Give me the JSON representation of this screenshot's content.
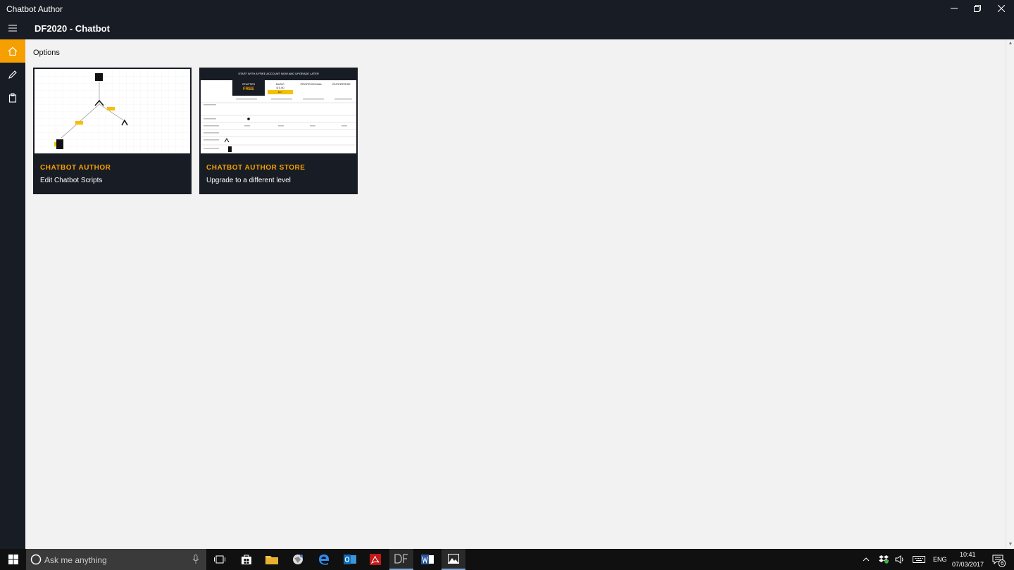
{
  "window": {
    "title": "Chatbot Author"
  },
  "appbar": {
    "title": "DF2020 - Chatbot"
  },
  "nav": {
    "items": [
      "home-icon",
      "pencil-icon",
      "clipboard-icon"
    ],
    "active_color": "#f5a000"
  },
  "content": {
    "heading": "Options"
  },
  "tiles": [
    {
      "name": "CHATBOT AUTHOR",
      "description": "Edit Chatbot Scripts"
    },
    {
      "name": "CHATBOT AUTHOR STORE",
      "description": "Upgrade to a different level"
    }
  ],
  "store_preview": {
    "banner": "START WITH A FREE ACCOUNT NOW AND UPGRADE LATER",
    "plans": [
      "STARTER",
      "BASIC",
      "PROFESSIONAL",
      "ENTERPRISE"
    ],
    "free_label": "FREE",
    "price": "$ 0.00",
    "buy_label": "BUY"
  },
  "taskbar": {
    "search_placeholder": "Ask me anything",
    "language": "ENG",
    "time": "10:41",
    "date": "07/03/2017",
    "notification_count": "6"
  },
  "colors": {
    "accent": "#f5a000",
    "chrome": "#181c24",
    "content_bg": "#f2f2f2"
  }
}
